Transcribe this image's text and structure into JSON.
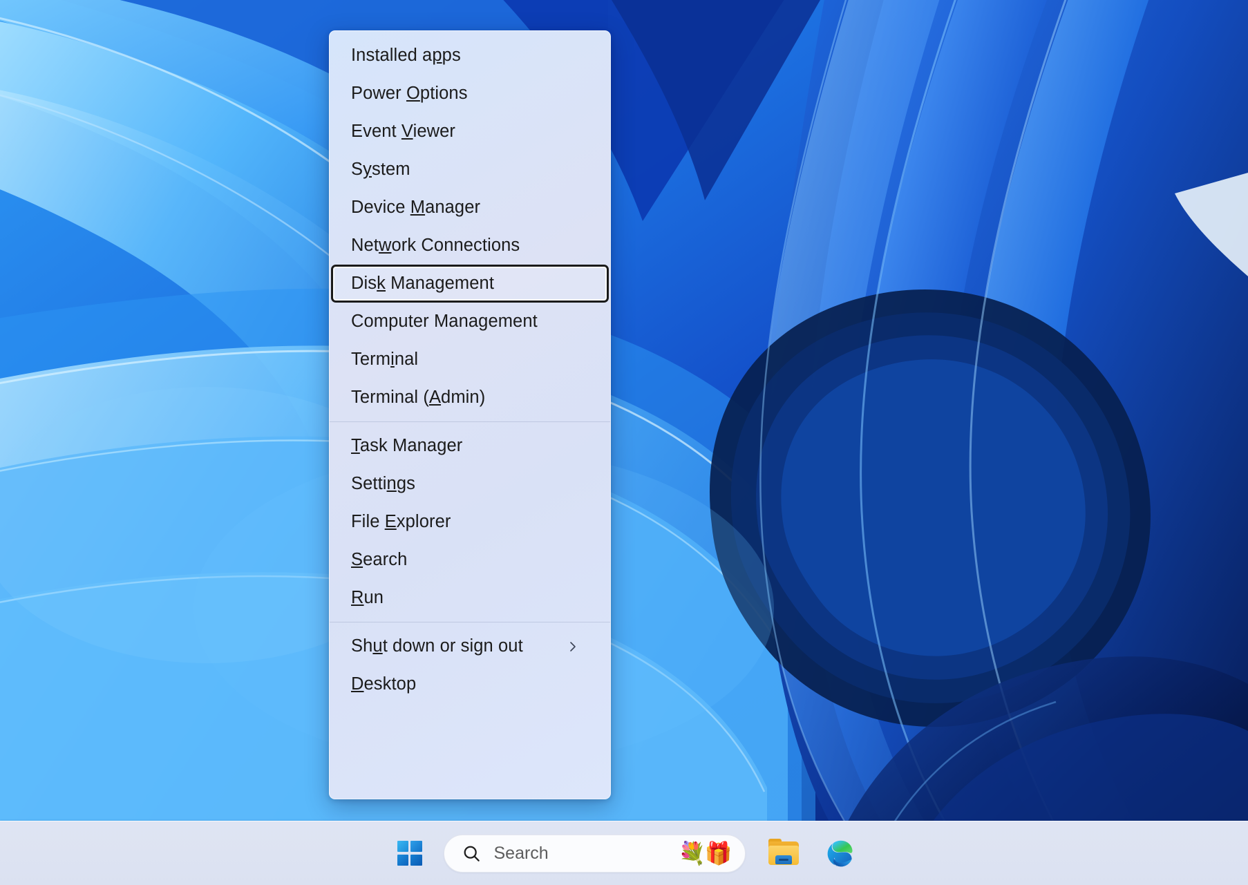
{
  "desktop": {
    "wallpaper_name": "windows-11-bloom-wallpaper",
    "colors": {
      "deep_blue": "#0a2d96",
      "mid_blue": "#1668e3",
      "light_blue": "#4aa8fb",
      "pale_blue": "#8fd0ff",
      "near_black_blue": "#061a4d",
      "highlight": "#cfe8ff"
    }
  },
  "power_menu": {
    "name": "Win+X quick link menu",
    "background_color": "#dde2f5",
    "focused_item": "Disk Management",
    "items": [
      {
        "id": "installed-apps",
        "label": "Installed apps",
        "pre": "Installed a",
        "key": "p",
        "post": "ps",
        "focused": false,
        "submenu": false
      },
      {
        "id": "power-options",
        "label": "Power Options",
        "pre": "Power ",
        "key": "O",
        "post": "ptions",
        "focused": false,
        "submenu": false
      },
      {
        "id": "event-viewer",
        "label": "Event Viewer",
        "pre": "Event ",
        "key": "V",
        "post": "iewer",
        "focused": false,
        "submenu": false
      },
      {
        "id": "system",
        "label": "System",
        "pre": "S",
        "key": "y",
        "post": "stem",
        "focused": false,
        "submenu": false
      },
      {
        "id": "device-manager",
        "label": "Device Manager",
        "pre": "Device ",
        "key": "M",
        "post": "anager",
        "focused": false,
        "submenu": false
      },
      {
        "id": "network-connections",
        "label": "Network Connections",
        "pre": "Net",
        "key": "w",
        "post": "ork Connections",
        "focused": false,
        "submenu": false
      },
      {
        "id": "disk-management",
        "label": "Disk Management",
        "pre": "Dis",
        "key": "k",
        "post": " Management",
        "focused": true,
        "submenu": false
      },
      {
        "id": "computer-management",
        "label": "Computer Management",
        "pre": "Computer Mana",
        "key": "g",
        "post": "ement",
        "focused": false,
        "submenu": false
      },
      {
        "id": "terminal",
        "label": "Terminal",
        "pre": "Term",
        "key": "i",
        "post": "nal",
        "focused": false,
        "submenu": false
      },
      {
        "id": "terminal-admin",
        "label": "Terminal (Admin)",
        "pre": "Terminal (",
        "key": "A",
        "post": "dmin)",
        "focused": false,
        "submenu": false
      },
      {
        "separator": true,
        "id": "separator-1"
      },
      {
        "id": "task-manager",
        "label": "Task Manager",
        "pre": "",
        "key": "T",
        "post": "ask Manager",
        "focused": false,
        "submenu": false
      },
      {
        "id": "settings",
        "label": "Settings",
        "pre": "Setti",
        "key": "n",
        "post": "gs",
        "focused": false,
        "submenu": false
      },
      {
        "id": "file-explorer",
        "label": "File Explorer",
        "pre": "File ",
        "key": "E",
        "post": "xplorer",
        "focused": false,
        "submenu": false
      },
      {
        "id": "search",
        "label": "Search",
        "pre": "",
        "key": "S",
        "post": "earch",
        "focused": false,
        "submenu": false
      },
      {
        "id": "run",
        "label": "Run",
        "pre": "",
        "key": "R",
        "post": "un",
        "focused": false,
        "submenu": false
      },
      {
        "separator": true,
        "id": "separator-2"
      },
      {
        "id": "shut-down-or-sign-out",
        "label": "Shut down or sign out",
        "pre": "Sh",
        "key": "u",
        "post": "t down or sign out",
        "focused": false,
        "submenu": true
      },
      {
        "id": "desktop",
        "label": "Desktop",
        "pre": "",
        "key": "D",
        "post": "esktop",
        "focused": false,
        "submenu": false
      }
    ]
  },
  "taskbar": {
    "background_color": "#dde3f2",
    "start_button": {
      "label": "Start",
      "icon": "windows-logo-icon"
    },
    "search": {
      "placeholder": "Search",
      "value": "",
      "icon": "search-icon",
      "decoration_emoji": "💐🎁"
    },
    "pinned_apps": [
      {
        "id": "file-explorer",
        "label": "File Explorer",
        "icon": "folder-icon"
      },
      {
        "id": "microsoft-edge",
        "label": "Microsoft Edge",
        "icon": "edge-icon"
      }
    ]
  }
}
